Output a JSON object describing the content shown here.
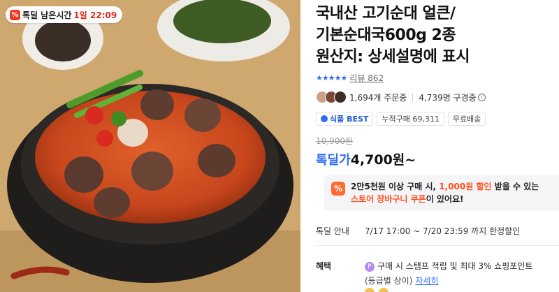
{
  "product": {
    "timer_badge": {
      "icon": "percent-icon",
      "label": "톡딜 남은시간",
      "time": "1일 22:09"
    },
    "title": "국내산 고기순대 얼큰/\n기본순대국600g 2종\n원산지: 상세설명에 표시",
    "rating": {
      "stars": "★★★★★",
      "review_label": "리뷰 862"
    },
    "stats": {
      "orders": "1,694개 주문중",
      "views": "4,739명 구경중"
    },
    "tags": [
      "식품 BEST",
      "누적구매 69,311",
      "무료배송"
    ],
    "original_price": "10,900원",
    "deal_label": "톡딜가",
    "price": "4,700원~",
    "coupon": {
      "line1_pre": "2만5천원 이상 구매 시, ",
      "line1_highlight": "1,000원 할인",
      "line1_post": " 받을 수 있는",
      "line2_highlight": "스토어 장바구니 쿠폰",
      "line2_post": "이 있어요!"
    },
    "deal_period": {
      "label": "톡딜 안내",
      "value": "7/17 17:00 ~ 7/20 23:59 까지 한정할인"
    },
    "benefit": {
      "label": "혜택",
      "line1": "구매 시 스탬프 적립 및 최대 3% 쇼핑포인트",
      "line2": "(등급별 상이)",
      "link": "자세히"
    }
  },
  "colors": {
    "accent": "#2f6df6",
    "deal_red": "#f03a1e",
    "coupon_orange": "#ff4e1a"
  }
}
